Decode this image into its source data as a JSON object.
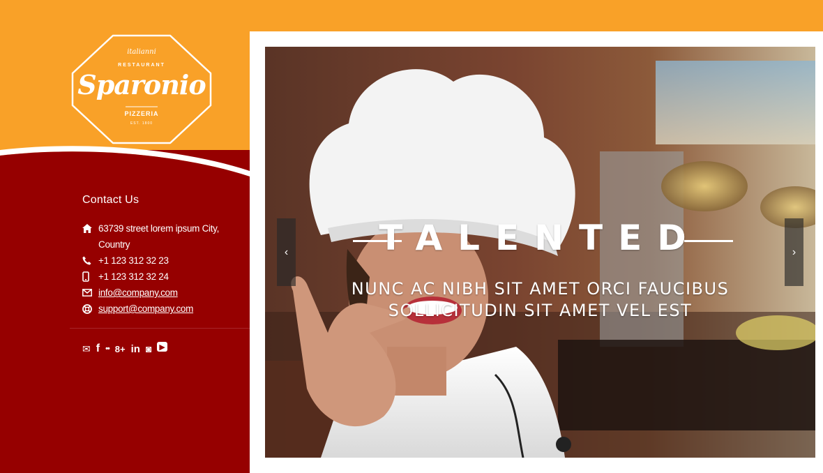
{
  "logo": {
    "subtitle": "italianni",
    "restaurant": "RESTAURANT",
    "name": "Sparonio",
    "pizzeria": "PIZZERIA",
    "est": "EST. 1800"
  },
  "contact": {
    "title": "Contact Us",
    "address_line1": "63739 street lorem ipsum City,",
    "address_line2": "Country",
    "phone": "+1 123 312 32 23",
    "mobile": "+1 123 312 32 24",
    "email": "info@company.com",
    "support": "support@company.com"
  },
  "social": {
    "mail": "✉",
    "facebook": "f",
    "flickr": "••",
    "googleplus": "8+",
    "linkedin": "in",
    "instagram": "◙",
    "youtube": "▶"
  },
  "slider": {
    "title": "TALENTED",
    "subtitle_line1": "NUNC AC NIBH SIT AMET ORCI FAUCIBUS",
    "subtitle_line2": "SOLLICITUDIN SIT AMET VEL EST",
    "prev_label": "‹",
    "next_label": "›"
  },
  "colors": {
    "orange": "#f9a128",
    "dark_red": "#960000",
    "white": "#ffffff"
  }
}
